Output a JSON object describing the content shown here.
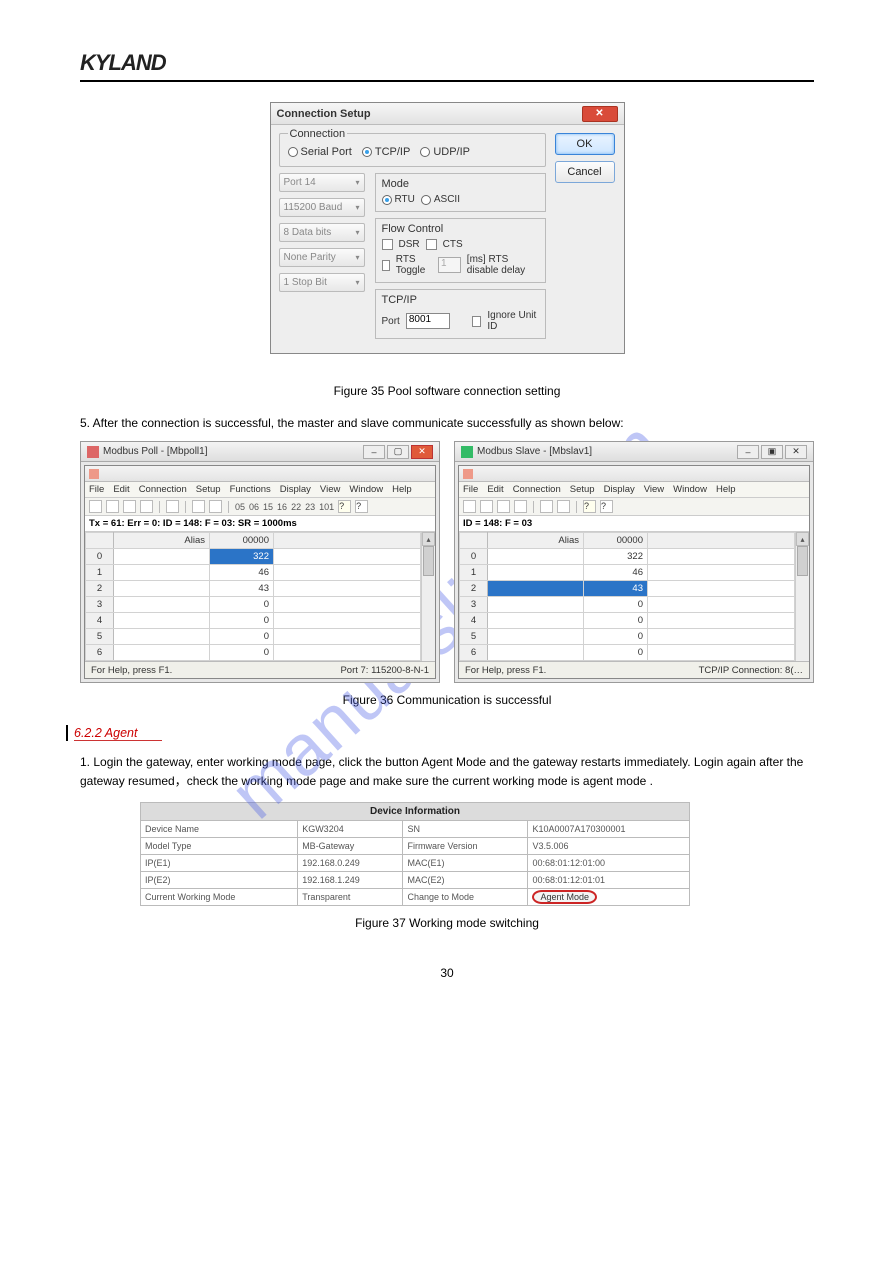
{
  "logo": "KYLAND",
  "watermark": "manualslive.com",
  "dialog": {
    "title": "Connection Setup",
    "group_connection": "Connection",
    "opt_serial": "Serial Port",
    "opt_tcp": "TCP/IP",
    "opt_udp": "UDP/IP",
    "combo_port": "Port 14",
    "combo_baud": "115200 Baud",
    "combo_data": "8 Data bits",
    "combo_parity": "None Parity",
    "combo_stop": "1 Stop Bit",
    "group_mode": "Mode",
    "opt_rtu": "RTU",
    "opt_ascii": "ASCII",
    "group_flow": "Flow Control",
    "chk_dsr": "DSR",
    "chk_cts": "CTS",
    "chk_rts": "RTS Toggle",
    "rts_val": "1",
    "rts_suffix": "[ms] RTS disable delay",
    "group_tcp": "TCP/IP",
    "lbl_port": "Port",
    "port_val": "8001",
    "chk_ignore": "Ignore Unit ID",
    "btn_ok": "OK",
    "btn_cancel": "Cancel"
  },
  "caption1": "Figure 35  Pool software connection setting",
  "body1": "5. After the connection is successful, the master and slave communicate successfully as shown below:",
  "poll": {
    "title": "Modbus Poll - [Mbpoll1]",
    "menu": [
      "File",
      "Edit",
      "Connection",
      "Setup",
      "Functions",
      "Display",
      "View",
      "Window",
      "Help"
    ],
    "tool_nums": [
      "05",
      "06",
      "15",
      "16",
      "22",
      "23",
      "101"
    ],
    "status": "Tx = 61: Err = 0: ID = 148: F = 03: SR = 1000ms",
    "hdr1": "Alias",
    "hdr2": "00000",
    "rows": [
      [
        "0",
        "",
        "322"
      ],
      [
        "1",
        "",
        "46"
      ],
      [
        "2",
        "",
        "43"
      ],
      [
        "3",
        "",
        "0"
      ],
      [
        "4",
        "",
        "0"
      ],
      [
        "5",
        "",
        "0"
      ],
      [
        "6",
        "",
        "0"
      ]
    ],
    "footer_left": "For Help, press F1.",
    "footer_right": "Port 7: 115200-8-N-1"
  },
  "slave": {
    "title": "Modbus Slave - [Mbslav1]",
    "menu": [
      "File",
      "Edit",
      "Connection",
      "Setup",
      "Display",
      "View",
      "Window",
      "Help"
    ],
    "status": "ID = 148: F = 03",
    "hdr1": "Alias",
    "hdr2": "00000",
    "rows": [
      [
        "0",
        "",
        "322"
      ],
      [
        "1",
        "",
        "46"
      ],
      [
        "2",
        "",
        "43"
      ],
      [
        "3",
        "",
        "0"
      ],
      [
        "4",
        "",
        "0"
      ],
      [
        "5",
        "",
        "0"
      ],
      [
        "6",
        "",
        "0"
      ]
    ],
    "footer_left": "For Help, press F1.",
    "footer_right": "TCP/IP Connection: 8(…"
  },
  "caption2": "Figure 36  Communication is successful",
  "section_heading": "6.2.2 Agent",
  "para1": "1. Login the gateway, enter working mode page, click the button Agent Mode and the gateway restarts immediately. Login again after the gateway resumed，check the working mode page and make sure the current working mode is agent mode .",
  "devinfo": {
    "title": "Device Information",
    "rows": [
      [
        "Device Name",
        "KGW3204",
        "SN",
        "K10A0007A170300001"
      ],
      [
        "Model Type",
        "MB-Gateway",
        "Firmware Version",
        "V3.5.006"
      ],
      [
        "IP(E1)",
        "192.168.0.249",
        "MAC(E1)",
        "00:68:01:12:01:00"
      ],
      [
        "IP(E2)",
        "192.168.1.249",
        "MAC(E2)",
        "00:68:01:12:01:01"
      ],
      [
        "Current Working Mode",
        "Transparent",
        "Change to Mode",
        "Agent  Mode"
      ]
    ]
  },
  "caption3": "Figure 37  Working mode switching",
  "pagenum": "30"
}
